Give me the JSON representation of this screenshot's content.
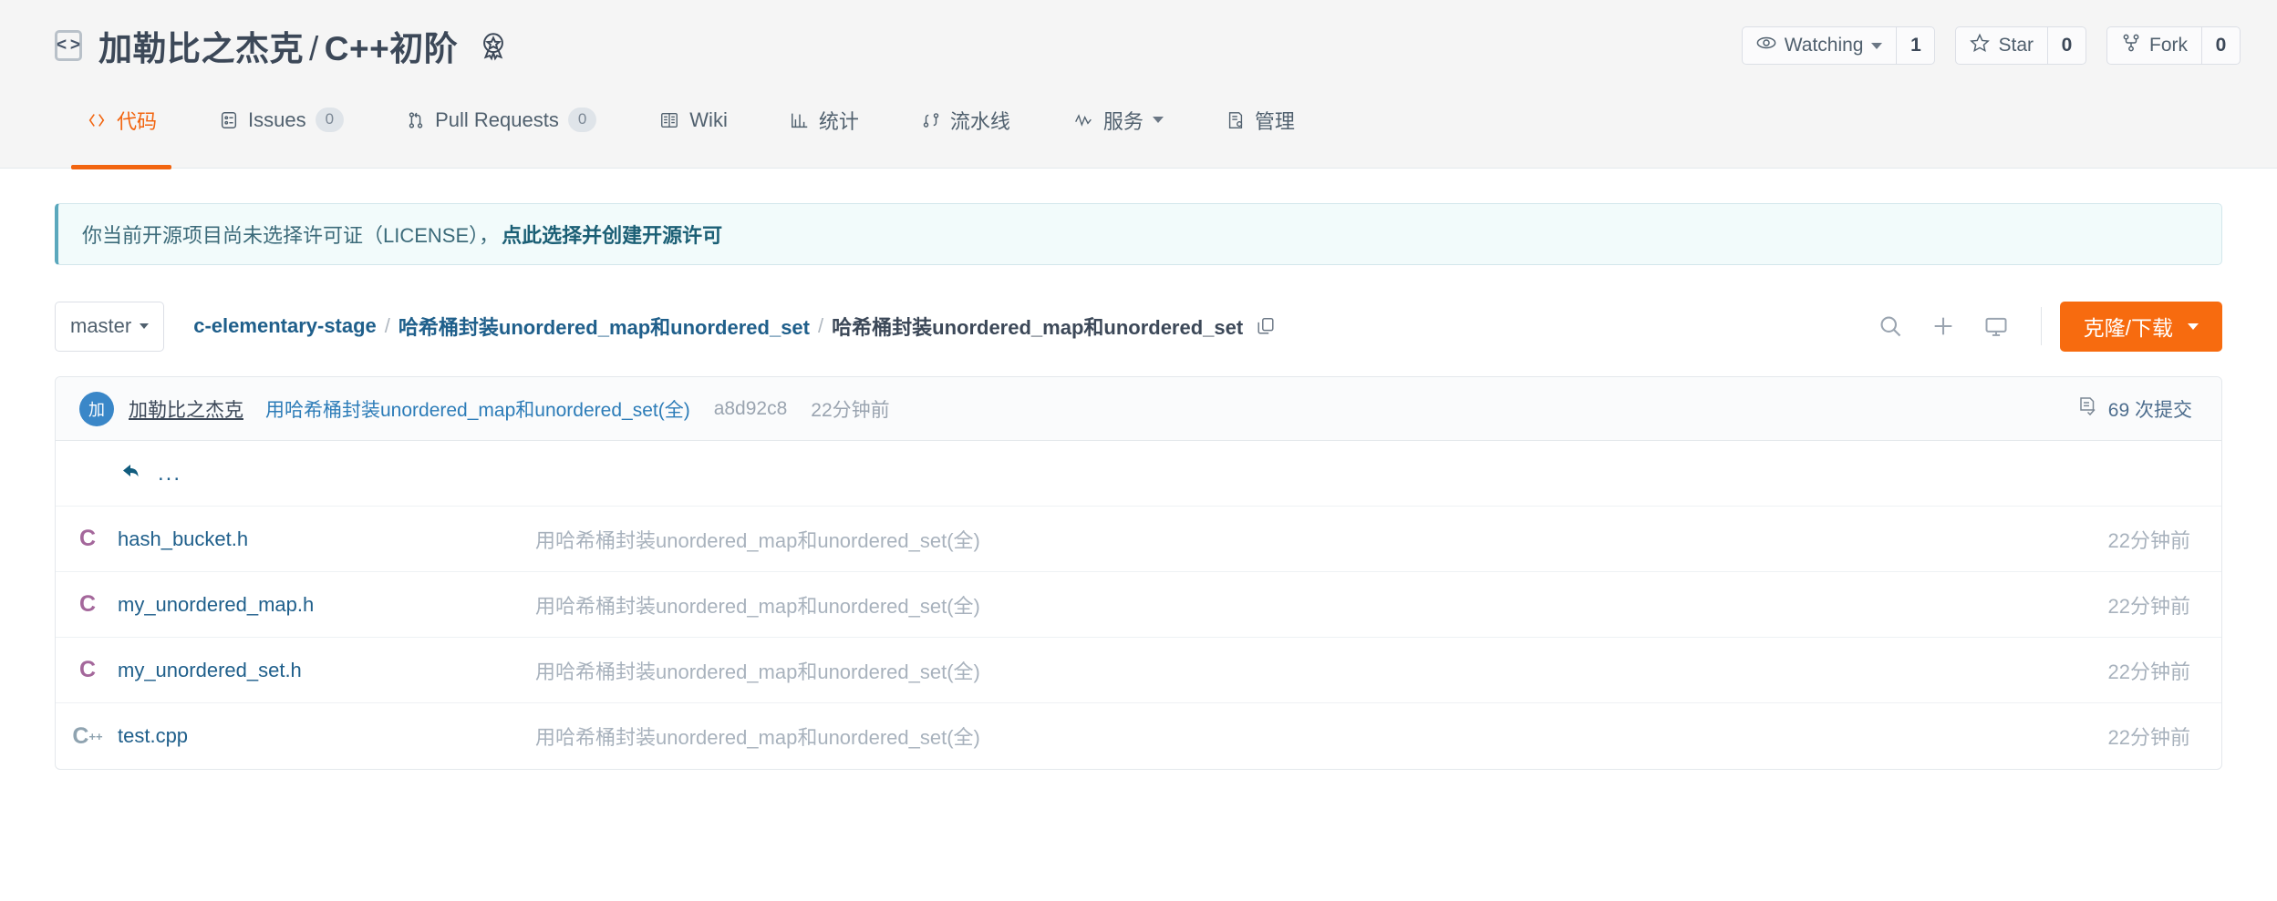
{
  "header": {
    "repo_icon": "code-brackets-icon",
    "owner": "加勒比之杰克",
    "separator": "/",
    "repo_name": "C++初阶",
    "badge_icon": "award-star-icon",
    "actions": [
      {
        "icon": "eye-icon",
        "label": "Watching",
        "has_caret": true,
        "count": "1",
        "name": "watch"
      },
      {
        "icon": "star-icon",
        "label": "Star",
        "has_caret": false,
        "count": "0",
        "name": "star"
      },
      {
        "icon": "fork-icon",
        "label": "Fork",
        "has_caret": false,
        "count": "0",
        "name": "fork"
      }
    ]
  },
  "nav": {
    "tabs": [
      {
        "label": "代码",
        "icon": "code-icon",
        "active": true,
        "count": null,
        "name": "code"
      },
      {
        "label": "Issues",
        "icon": "issue-icon",
        "active": false,
        "count": "0",
        "name": "issues"
      },
      {
        "label": "Pull Requests",
        "icon": "pull-request-icon",
        "active": false,
        "count": "0",
        "name": "pull-requests"
      },
      {
        "label": "Wiki",
        "icon": "book-icon",
        "active": false,
        "count": null,
        "name": "wiki"
      },
      {
        "label": "统计",
        "icon": "chart-icon",
        "active": false,
        "count": null,
        "name": "statistics"
      },
      {
        "label": "流水线",
        "icon": "pipeline-icon",
        "active": false,
        "count": null,
        "name": "pipeline"
      },
      {
        "label": "服务",
        "icon": "activity-icon",
        "active": false,
        "count": null,
        "caret": true,
        "name": "services"
      },
      {
        "label": "管理",
        "icon": "settings-doc-icon",
        "active": false,
        "count": null,
        "name": "manage"
      }
    ]
  },
  "license_notice": {
    "text": "你当前开源项目尚未选择许可证（LICENSE），",
    "link_text": "点此选择并创建开源许可",
    "accent": "#5ba8bd"
  },
  "path_row": {
    "branch": "master",
    "breadcrumb": [
      {
        "label": "c-elementary-stage",
        "is_link": true
      },
      {
        "label": "哈希桶封装unordered_map和unordered_set",
        "is_link": true
      },
      {
        "label": "哈希桶封装unordered_map和unordered_set",
        "is_link": false
      }
    ],
    "copy_icon": "copy-icon",
    "tools": [
      {
        "icon": "search-icon",
        "name": "search-files"
      },
      {
        "icon": "plus-icon",
        "name": "add-file"
      },
      {
        "icon": "monitor-icon",
        "name": "web-ide"
      }
    ],
    "clone_button": {
      "label": "克隆/下载",
      "color": "#f76b0f"
    }
  },
  "commit_bar": {
    "avatar_text": "加",
    "author": "加勒比之杰克",
    "message": "用哈希桶封装unordered_map和unordered_set(全)",
    "sha": "a8d92c8",
    "time": "22分钟前",
    "commit_count_icon": "commit-list-icon",
    "commit_count_label": "69 次提交"
  },
  "files": {
    "parent_dir_label": "...",
    "rows": [
      {
        "icon": "c-header-file-icon",
        "icon_text": "C",
        "icon_color": "#a4679b",
        "name": "hash_bucket.h",
        "message": "用哈希桶封装unordered_map和unordered_set(全)",
        "time": "22分钟前"
      },
      {
        "icon": "c-header-file-icon",
        "icon_text": "C",
        "icon_color": "#a4679b",
        "name": "my_unordered_map.h",
        "message": "用哈希桶封装unordered_map和unordered_set(全)",
        "time": "22分钟前"
      },
      {
        "icon": "c-header-file-icon",
        "icon_text": "C",
        "icon_color": "#a4679b",
        "name": "my_unordered_set.h",
        "message": "用哈希桶封装unordered_map和unordered_set(全)",
        "time": "22分钟前"
      },
      {
        "icon": "cpp-file-icon",
        "icon_text": "C",
        "icon_color": "#8fa3b0",
        "name": "test.cpp",
        "message": "用哈希桶封装unordered_map和unordered_set(全)",
        "time": "22分钟前"
      }
    ]
  }
}
